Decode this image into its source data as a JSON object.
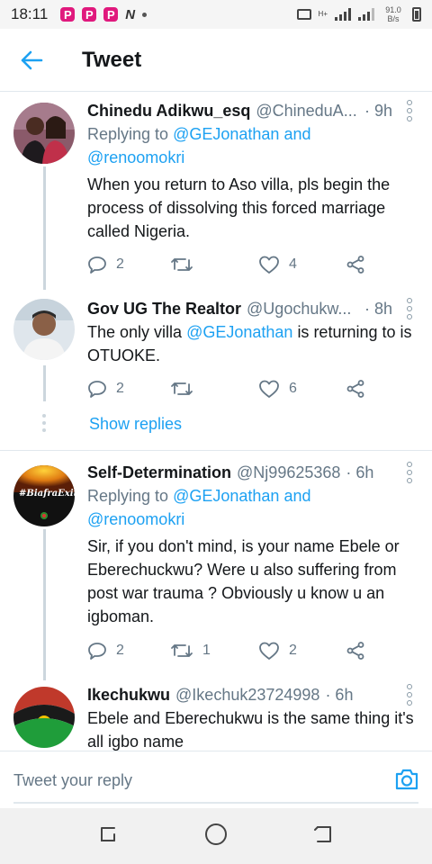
{
  "status_bar": {
    "time": "18:11",
    "apps": [
      "P",
      "P",
      "P"
    ],
    "n_label": "N",
    "network": "H+",
    "speed_value": "91.0",
    "speed_unit": "B/s"
  },
  "header": {
    "title": "Tweet"
  },
  "tweets": [
    {
      "name": "Chinedu Adikwu_esq",
      "handle": "@ChineduA...",
      "time": "· 9h",
      "reply_prefix": "Replying to",
      "reply_handle_1": "@GEJonathan",
      "reply_and": "and",
      "reply_handle_2": "@renoomokri",
      "text": "When you return to Aso villa, pls begin the process of dissolving this forced marriage called Nigeria.",
      "replies": "2",
      "retweets": "",
      "likes": "4"
    },
    {
      "name": "Gov UG The Realtor",
      "handle": "@Ugochukw...",
      "time": "· 8h",
      "text_before": "The only villa",
      "text_link": "@GEJonathan",
      "text_after": "is returning to is OTUOKE.",
      "replies": "2",
      "retweets": "",
      "likes": "6",
      "show_replies": "Show replies"
    },
    {
      "name": "Self-Determination",
      "handle": "@Nj99625368",
      "time": "· 6h",
      "avatar_text": "#BiafraExit",
      "reply_prefix": "Replying to",
      "reply_handle_1": "@GEJonathan",
      "reply_and": "and",
      "reply_handle_2": "@renoomokri",
      "text": "Sir, if you don't mind, is your name Ebele or Eberechuckwu? Were u also suffering from post war trauma ? Obviously u know u an igboman.",
      "replies": "2",
      "retweets": "1",
      "likes": "2"
    },
    {
      "name": "Ikechukwu",
      "handle": "@Ikechuk23724998",
      "time": "· 6h",
      "text": "Ebele and Eberechukwu is the same thing it's all igbo name"
    }
  ],
  "compose": {
    "placeholder": "Tweet your reply"
  },
  "colors": {
    "accent": "#1da1f2",
    "muted": "#657786",
    "text": "#14171a",
    "divider": "#e1e8ed"
  },
  "icons": [
    "back-arrow-icon",
    "more-icon",
    "reply-icon",
    "retweet-icon",
    "like-icon",
    "share-icon",
    "camera-icon",
    "recent-apps-icon",
    "home-icon",
    "back-nav-icon"
  ]
}
